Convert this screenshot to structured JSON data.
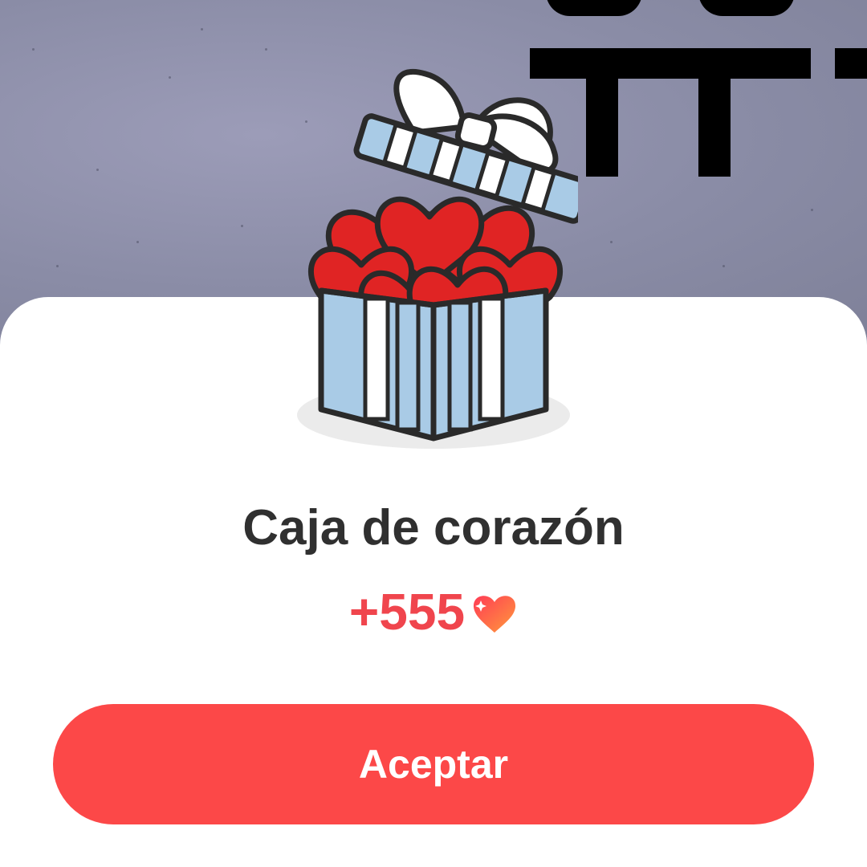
{
  "reward_dialog": {
    "title": "Caja de corazón",
    "reward_amount": "+555",
    "reward_icon": "heart-icon",
    "accept_label": "Aceptar",
    "gift_icon": "gift-box-icon"
  },
  "colors": {
    "accent": "#fc4848",
    "reward_text": "#f0454d",
    "title_text": "#303030",
    "box_blue": "#a9cbe6",
    "heart_red": "#e02424"
  }
}
